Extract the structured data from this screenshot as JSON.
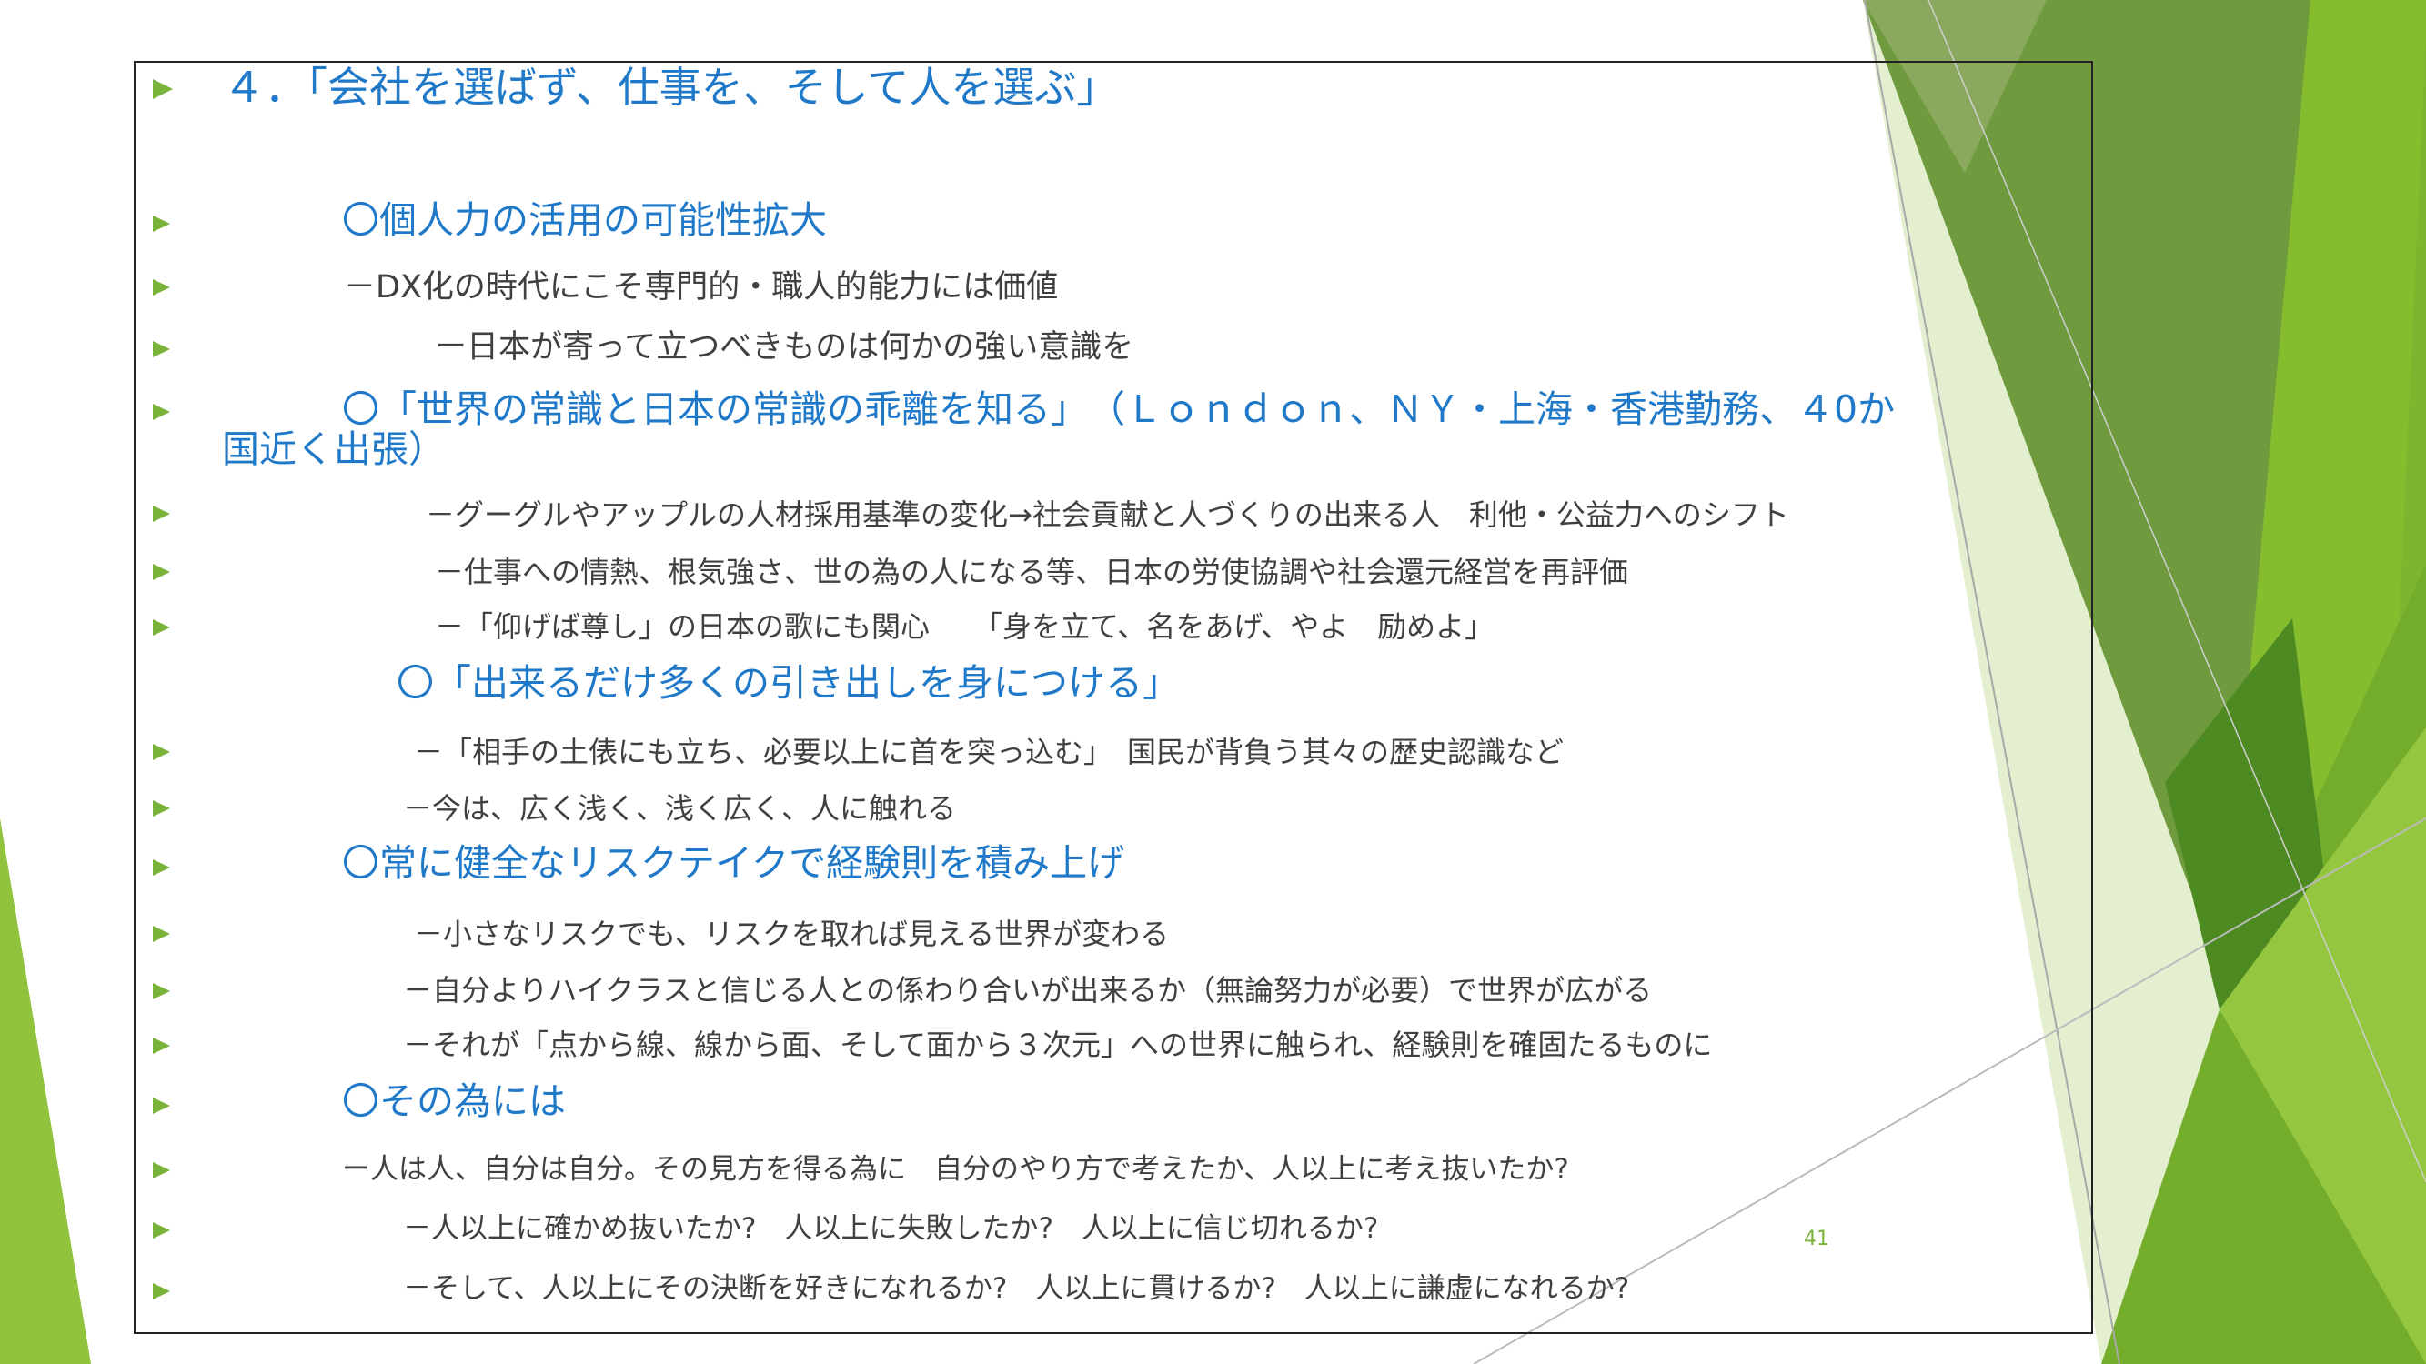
{
  "colors": {
    "accent_green": "#7ab33a",
    "heading_blue": "#1f79c8",
    "body_text": "#404040"
  },
  "bullet_icon": "triangle-right-icon",
  "title": "４．「会社を選ばず、仕事を、そして人を選ぶ」",
  "lines": [
    "〇個人力の活用の可能性拡大",
    "－DX化の時代にこそ専門的・職人的能力には価値",
    "ー日本が寄って立つべきものは何かの強い意識を",
    "〇「世界の常識と日本の常識の乖離を知る」　（Ｌｏｎｄｏｎ、ＮＹ・上海・香港勤務、４0か",
    "国近く出張）",
    "－グーグルやアップルの人材採用基準の変化→社会貢献と人づくりの出来る人　利他・公益力へのシフト",
    "－仕事への情熱、根気強さ、世の為の人になる等、日本の労使協調や社会還元経営を再評価",
    "－「仰げば尊し」の日本の歌にも関心　　「身を立て、名をあげ、やよ　励めよ」",
    "〇「出来るだけ多くの引き出しを身につける」",
    "－「相手の土俵にも立ち、必要以上に首を突っ込む」　国民が背負う其々の歴史認識など",
    "－今は、広く浅く、浅く広く、人に触れる",
    "〇常に健全なリスクテイクで経験則を積み上げ",
    "－小さなリスクでも、リスクを取れば見える世界が変わる",
    "－自分よりハイクラスと信じる人との係わり合いが出来るか（無論努力が必要）で世界が広がる",
    "－それが「点から線、線から面、そして面から３次元」への世界に触られ、経験則を確固たるものに",
    "〇その為には",
    "ー人は人、自分は自分。その見方を得る為に　自分のやり方で考えたか、人以上に考え抜いたか?",
    "－人以上に確かめ抜いたか?　人以上に失敗したか?　人以上に信じ切れるか?",
    "－そして、人以上にその決断を好きになれるか?　人以上に貫けるか?　人以上に謙虚になれるか?"
  ],
  "page_number": "41"
}
